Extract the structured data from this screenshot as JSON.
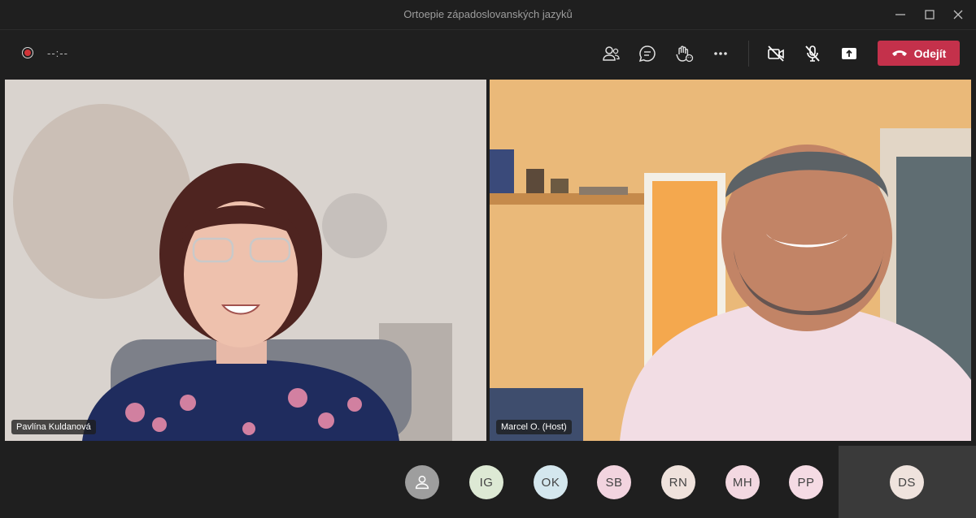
{
  "window": {
    "title": "Ortoepie západoslovanských jazyků"
  },
  "toolbar": {
    "timer": "--:--",
    "leave_label": "Odejít"
  },
  "icons": [
    "record-icon",
    "people-icon",
    "chat-icon",
    "raise-hand-icon",
    "more-options-icon",
    "camera-off-icon",
    "mic-off-icon",
    "share-screen-icon",
    "phone-hangup-icon",
    "minimize-icon",
    "maximize-icon",
    "close-icon"
  ],
  "participants_video": [
    {
      "name": "Pavlína Kuldanová"
    },
    {
      "name": "Marcel O. (Host)"
    }
  ],
  "participants_strip": [
    {
      "initials": "",
      "color": "#9e9e9e",
      "icon": "person-icon"
    },
    {
      "initials": "IG",
      "color": "#dde9d4"
    },
    {
      "initials": "OK",
      "color": "#d4e7ee"
    },
    {
      "initials": "SB",
      "color": "#f2d4df"
    },
    {
      "initials": "RN",
      "color": "#efe2dc"
    },
    {
      "initials": "MH",
      "color": "#f3d8e1"
    },
    {
      "initials": "PP",
      "color": "#f5dbe4"
    },
    {
      "initials": "DS",
      "color": "#efe3dd"
    }
  ],
  "colors": {
    "leave": "#c4314b",
    "record": "#d13438",
    "background": "#1f1f1f"
  }
}
